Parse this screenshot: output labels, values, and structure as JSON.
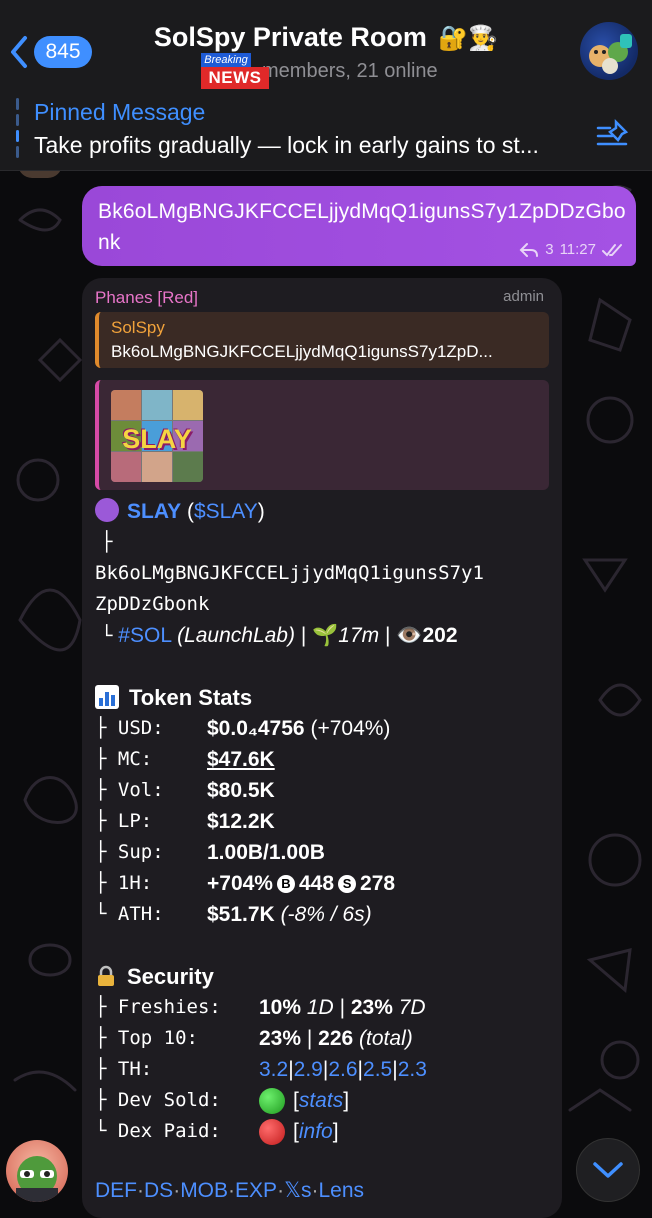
{
  "header": {
    "back_count": "845",
    "title": "SolSpy Private Room",
    "title_emoji": "🔐👨‍🍳",
    "subtitle": "members, 21 online",
    "news_badge_top": "Breaking",
    "news_badge_bottom": "NEWS"
  },
  "pinned": {
    "title": "Pinned Message",
    "text": "Take profits gradually — lock in early gains to st..."
  },
  "outgoing": {
    "text": "Bk6oLMgBNGJKFCCELjjydMqQ1igunsS7y1ZpDDzGbonk",
    "reply_count": "3",
    "time": "11:27"
  },
  "incoming": {
    "sender": "Phanes [Red]",
    "admin": "admin",
    "reply_name": "SolSpy",
    "reply_text": "Bk6oLMgBNGJKFCCELjjydMqQ1igunsS7y1ZpD...",
    "preview_label": "SLAY",
    "token_name": "SLAY",
    "token_ticker": "($SLAY)",
    "branch_top": "├",
    "ca_line1": "Bk6oLMgBNGJKFCCELjjydMqQ1igunsS7y1",
    "ca_line2": "ZpDDzGbonk",
    "branch_end": "└",
    "chain": "#SOL",
    "launchpad": "(LaunchLab)",
    "sep": "|",
    "age_emoji": "🌱",
    "age": "17m",
    "views_emoji": "👁️",
    "views": "202",
    "stats_title": "Token Stats",
    "stats": {
      "usd_key": "├ USD:",
      "usd_val": "$0.0₄4756",
      "usd_change": "(+704%)",
      "mc_key": "├ MC:",
      "mc_val": "$47.6K",
      "vol_key": "├ Vol:",
      "vol_val": "$80.5K",
      "lp_key": "├ LP:",
      "lp_val": "$12.2K",
      "sup_key": "├ Sup:",
      "sup_val": "1.00B/1.00B",
      "h1_key": "├ 1H:",
      "h1_val": "+704%",
      "h1_buy_icon": "B",
      "h1_buys": "448",
      "h1_sell_icon": "S",
      "h1_sells": "278",
      "ath_key": "└ ATH:",
      "ath_val": "$51.7K",
      "ath_detail": "(-8% / 6s)"
    },
    "security_title": "Security",
    "security": {
      "fresh_key": "├ Freshies:",
      "fresh_a": "10%",
      "fresh_a_span": "1D",
      "fresh_b": "23%",
      "fresh_b_span": "7D",
      "top_key": "├ Top 10:",
      "top_val": "23%",
      "top_total": "226",
      "top_total_label": "(total)",
      "th_key": "├ TH:",
      "th_values": [
        "3.2",
        "2.9",
        "2.6",
        "2.5",
        "2.3"
      ],
      "dev_key": "├ Dev Sold:",
      "dev_link": "stats",
      "dex_key": "└ Dex Paid:",
      "dex_link": "info"
    },
    "footer_links": [
      "DEF",
      "DS",
      "MOB",
      "EXP",
      "𝕏s",
      "Lens"
    ]
  },
  "colors": {
    "accent": "#3f8fff",
    "outgoing_bubble": "#a04ee0",
    "incoming_bubble": "#1e1c21",
    "sender": "#e875c9",
    "link": "#4d8fff"
  }
}
